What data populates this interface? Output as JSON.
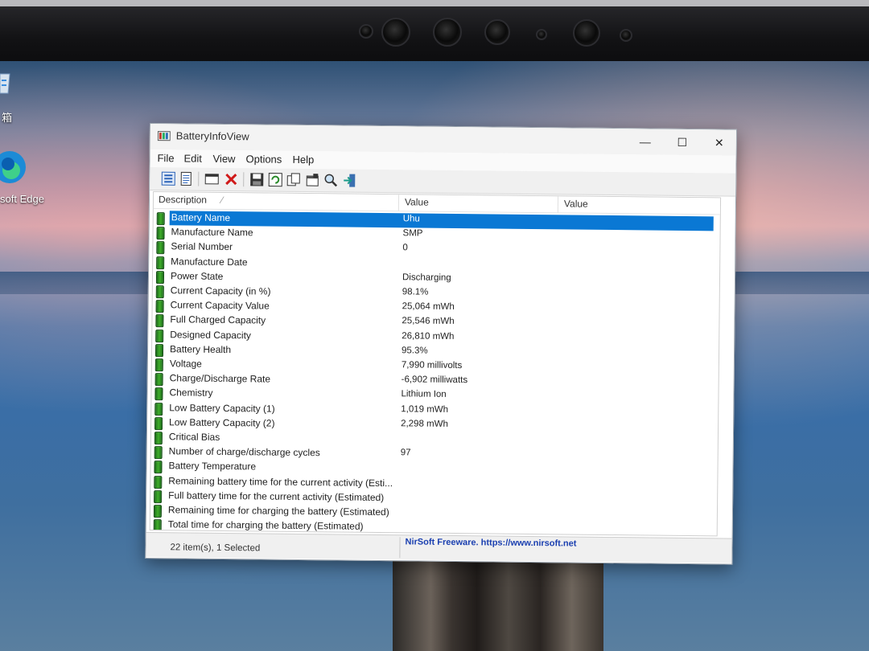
{
  "desktop": {
    "icons": [
      {
        "name": "recycle-bin-icon",
        "label": "箱"
      },
      {
        "name": "edge-icon",
        "label": "soft Edge"
      }
    ]
  },
  "window": {
    "title": "BatteryInfoView",
    "controls": {
      "minimize": "—",
      "maximize": "☐",
      "close": "✕"
    }
  },
  "menu": [
    "File",
    "Edit",
    "View",
    "Options",
    "Help"
  ],
  "toolbar": {
    "buttons": [
      "properties-icon",
      "properties-list-icon",
      "window-icon",
      "delete-icon",
      "save-icon",
      "refresh-icon",
      "copy-icon",
      "html-report-icon",
      "find-icon",
      "exit-icon"
    ]
  },
  "list": {
    "columns": [
      "Description",
      "Value",
      "Value"
    ],
    "sort_indicator": "⁄",
    "rows": [
      {
        "desc": "Battery Name",
        "value": "Uhu",
        "selected": true
      },
      {
        "desc": "Manufacture Name",
        "value": "SMP"
      },
      {
        "desc": "Serial Number",
        "value": "0"
      },
      {
        "desc": "Manufacture Date",
        "value": ""
      },
      {
        "desc": "Power State",
        "value": "Discharging"
      },
      {
        "desc": "Current Capacity (in %)",
        "value": "98.1%"
      },
      {
        "desc": "Current Capacity Value",
        "value": "25,064 mWh"
      },
      {
        "desc": "Full Charged Capacity",
        "value": "25,546 mWh"
      },
      {
        "desc": "Designed Capacity",
        "value": "26,810 mWh"
      },
      {
        "desc": "Battery Health",
        "value": "95.3%"
      },
      {
        "desc": "Voltage",
        "value": "7,990 millivolts"
      },
      {
        "desc": "Charge/Discharge Rate",
        "value": "-6,902 milliwatts"
      },
      {
        "desc": "Chemistry",
        "value": "Lithium Ion"
      },
      {
        "desc": "Low Battery Capacity (1)",
        "value": "1,019 mWh"
      },
      {
        "desc": "Low Battery Capacity (2)",
        "value": "2,298 mWh"
      },
      {
        "desc": "Critical Bias",
        "value": ""
      },
      {
        "desc": "Number of charge/discharge cycles",
        "value": "97"
      },
      {
        "desc": "Battery Temperature",
        "value": ""
      },
      {
        "desc": "Remaining battery time for the current activity (Esti...",
        "value": ""
      },
      {
        "desc": "Full battery time for the current activity (Estimated)",
        "value": ""
      },
      {
        "desc": "Remaining time for charging the battery (Estimated)",
        "value": ""
      },
      {
        "desc": "Total  time for charging the battery (Estimated)",
        "value": ""
      }
    ]
  },
  "status": {
    "items": "22 item(s), 1 Selected",
    "link": "NirSoft Freeware. https://www.nirsoft.net"
  },
  "colors": {
    "selection": "#0078d7",
    "battery_icon": "#3fae2a",
    "link": "#1a3fb0"
  }
}
